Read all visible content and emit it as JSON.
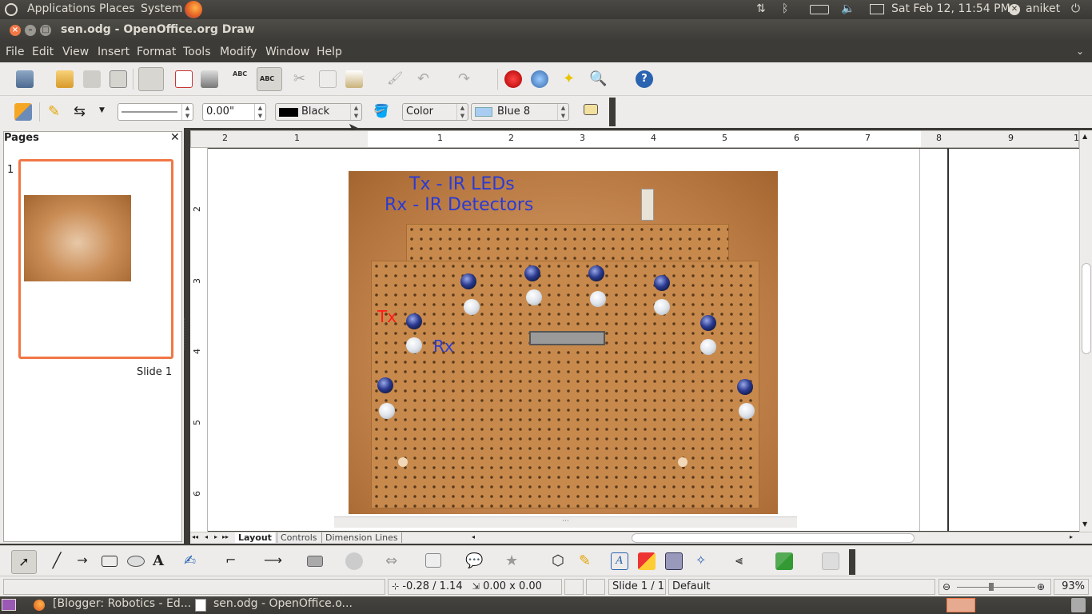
{
  "topbar": {
    "applications": "Applications",
    "places": "Places",
    "system": "System",
    "datetime": "Sat Feb 12, 11:54 PM",
    "user": "aniket"
  },
  "window": {
    "title": "sen.odg - OpenOffice.org Draw"
  },
  "menubar": [
    "File",
    "Edit",
    "View",
    "Insert",
    "Format",
    "Tools",
    "Modify",
    "Window",
    "Help"
  ],
  "line_toolbar": {
    "line_width": "0.00\"",
    "line_color": "Black",
    "fill_type": "Color",
    "fill_color": "Blue 8"
  },
  "pages_panel": {
    "title": "Pages",
    "page_number": "1",
    "slide_label": "Slide 1"
  },
  "ruler": {
    "h_ticks": [
      "2",
      "1",
      "1",
      "2",
      "3",
      "4",
      "5",
      "6",
      "7",
      "8",
      "9",
      "1"
    ],
    "v_ticks": [
      "2",
      "3",
      "4",
      "5",
      "6"
    ]
  },
  "image_content": {
    "title_line1": "Tx - IR LEDs",
    "title_line2": "Rx - IR Detectors",
    "tx_label": "Tx",
    "rx_label": "Rx"
  },
  "layer_tabs": [
    "Layout",
    "Controls",
    "Dimension Lines"
  ],
  "status": {
    "position": "-0.28 / 1.14",
    "size": "0.00 x 0.00",
    "slide": "Slide 1 / 1",
    "layout": "Default",
    "zoom": "93%"
  },
  "taskbar": {
    "items": [
      "[Blogger: Robotics - Ed...",
      "sen.odg - OpenOffice.o..."
    ]
  },
  "colors": {
    "panel_bg": "#3c3b37",
    "toolbar_bg": "#edeceb",
    "accent_orange": "#f07746",
    "fill_blue8": "#a9cdf2",
    "label_blue": "#2a3bd4",
    "label_red": "#ff1a1a"
  }
}
